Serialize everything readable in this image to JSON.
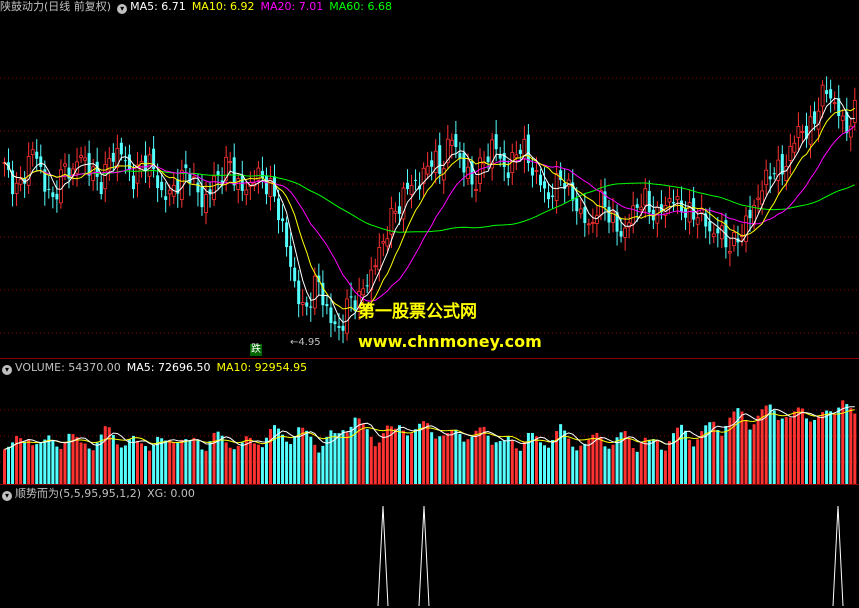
{
  "main_header": {
    "title": "陕鼓动力(日线 前复权)",
    "ma5": "MA5: 6.71",
    "ma10": "MA10: 6.92",
    "ma20": "MA20: 7.01",
    "ma60": "MA60: 6.68"
  },
  "volume_header": {
    "volume": "VOLUME: 54370.00",
    "ma5": "MA5: 72696.50",
    "ma10": "MA10: 92954.95"
  },
  "indicator_header": {
    "name": "顺势而为(5,5,95,95,1,2)",
    "xg": "XG: 0.00"
  },
  "annotations": {
    "low_price": "←4.95",
    "fall_badge": "跌"
  },
  "watermark": {
    "line1": "第一股票公式网",
    "line2": "www.chnmoney.com"
  },
  "colors": {
    "up": "#ff3232",
    "down": "#54ffff",
    "ma5": "#ffffff",
    "ma10": "#ffff00",
    "ma20": "#ff00ff",
    "ma60": "#00ff00",
    "grid": "#8b0000"
  },
  "chart_data": {
    "type": "candlestick",
    "y_low_marker": 4.95,
    "close_path": [
      7.6,
      7.4,
      7.2,
      7.5,
      7.9,
      7.7,
      7.3,
      7.0,
      7.4,
      7.6,
      7.5,
      7.8,
      7.7,
      7.5,
      7.3,
      7.6,
      7.8,
      7.9,
      7.6,
      7.4,
      7.6,
      7.8,
      7.5,
      7.2,
      7.1,
      7.3,
      7.4,
      7.6,
      7.3,
      7.0,
      7.2,
      7.4,
      7.5,
      7.7,
      7.4,
      7.2,
      7.3,
      7.5,
      7.4,
      7.3,
      7.0,
      6.6,
      6.0,
      5.6,
      5.2,
      5.5,
      5.8,
      5.4,
      5.1,
      4.95,
      5.2,
      5.5,
      5.4,
      5.7,
      5.9,
      6.2,
      6.5,
      6.8,
      7.0,
      7.2,
      7.4,
      7.3,
      7.6,
      7.8,
      7.5,
      7.9,
      8.1,
      7.7,
      7.5,
      7.3,
      7.6,
      7.8,
      8.0,
      7.7,
      7.5,
      7.8,
      8.0,
      7.7,
      7.5,
      7.3,
      7.1,
      7.3,
      7.5,
      7.2,
      7.0,
      6.8,
      6.6,
      6.9,
      7.1,
      6.8,
      6.6,
      6.5,
      6.8,
      7.0,
      7.1,
      6.9,
      6.8,
      7.0,
      7.1,
      7.0,
      6.9,
      6.8,
      6.9,
      6.7,
      6.5,
      6.6,
      6.4,
      6.3,
      6.5,
      6.7,
      6.9,
      7.2,
      7.4,
      7.6,
      7.5,
      7.7,
      8.0,
      8.3,
      8.1,
      8.4,
      8.7,
      8.9,
      8.6,
      8.4,
      8.2,
      8.5
    ],
    "volume_path": [
      6,
      5,
      6,
      5,
      7,
      6,
      5,
      6,
      5,
      6,
      7,
      6,
      5,
      6,
      5,
      6,
      8,
      7,
      6,
      5,
      6,
      5,
      6,
      5,
      6,
      5,
      6,
      7,
      6,
      5,
      6,
      5,
      6,
      7,
      6,
      5,
      6,
      5,
      6,
      5,
      6,
      7,
      8,
      7,
      6,
      7,
      8,
      7,
      6,
      5,
      6,
      7,
      6,
      8,
      9,
      10,
      8,
      7,
      6,
      7,
      8,
      7,
      9,
      8,
      7,
      8,
      9,
      8,
      7,
      6,
      7,
      8,
      7,
      6,
      7,
      8,
      7,
      6,
      5,
      6,
      5,
      6,
      7,
      6,
      5,
      6,
      7,
      8,
      6,
      5,
      6,
      5,
      6,
      7,
      6,
      5,
      6,
      7,
      6,
      5,
      6,
      5,
      6,
      5,
      6,
      7,
      8,
      7,
      6,
      7,
      8,
      9,
      8,
      9,
      10,
      11,
      10,
      9,
      10,
      11,
      12,
      11,
      10,
      9,
      11,
      12,
      10,
      9,
      10,
      11,
      12,
      13,
      11,
      10
    ],
    "signal_indices": [
      95,
      105,
      208
    ]
  }
}
